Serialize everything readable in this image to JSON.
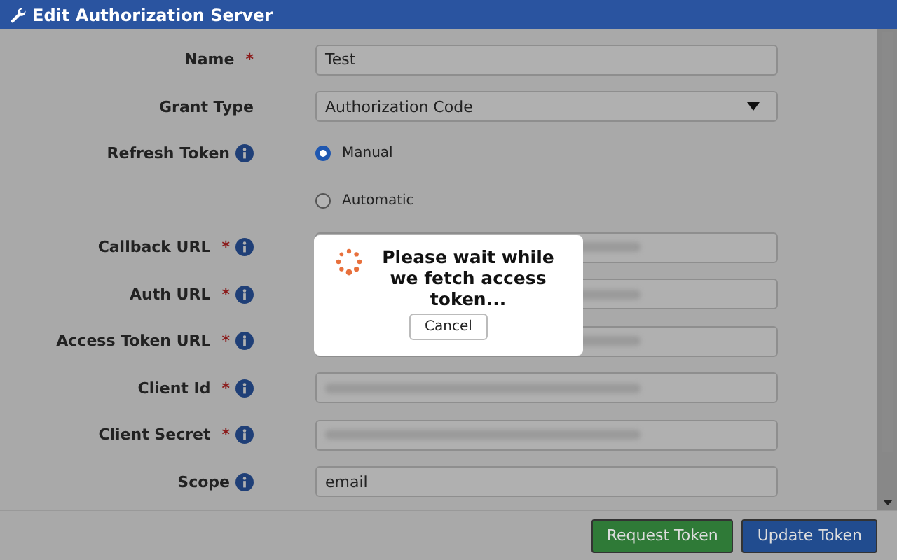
{
  "window": {
    "title": "Edit Authorization Server"
  },
  "fields": [
    {
      "label": "Name",
      "required": true,
      "info": false,
      "kind": "text",
      "value": "Test"
    },
    {
      "label": "Grant Type",
      "required": false,
      "info": false,
      "kind": "select",
      "value": "Authorization Code"
    },
    {
      "label": "Refresh Token",
      "required": false,
      "info": true,
      "kind": "radio",
      "value": "Manual",
      "selected": true
    },
    {
      "required": false,
      "info": false,
      "kind": "radio",
      "value": "Automatic",
      "selected": false
    },
    {
      "label": "Callback URL",
      "required": true,
      "info": true,
      "kind": "blurred"
    },
    {
      "label": "Auth URL",
      "required": true,
      "info": true,
      "kind": "blurred"
    },
    {
      "label": "Access Token URL",
      "required": true,
      "info": true,
      "kind": "blurred"
    },
    {
      "label": "Client Id",
      "required": true,
      "info": true,
      "kind": "blurred"
    },
    {
      "label": "Client Secret",
      "required": true,
      "info": true,
      "kind": "blurred"
    },
    {
      "label": "Scope",
      "required": false,
      "info": true,
      "kind": "text",
      "value": "email"
    }
  ],
  "required_mark": "*",
  "dialog": {
    "message": "Please wait while we fetch access token...",
    "button": "Cancel"
  },
  "buttons": [
    {
      "label": "Request Token",
      "kind": "success"
    },
    {
      "label": "Update Token",
      "kind": "primary"
    }
  ]
}
